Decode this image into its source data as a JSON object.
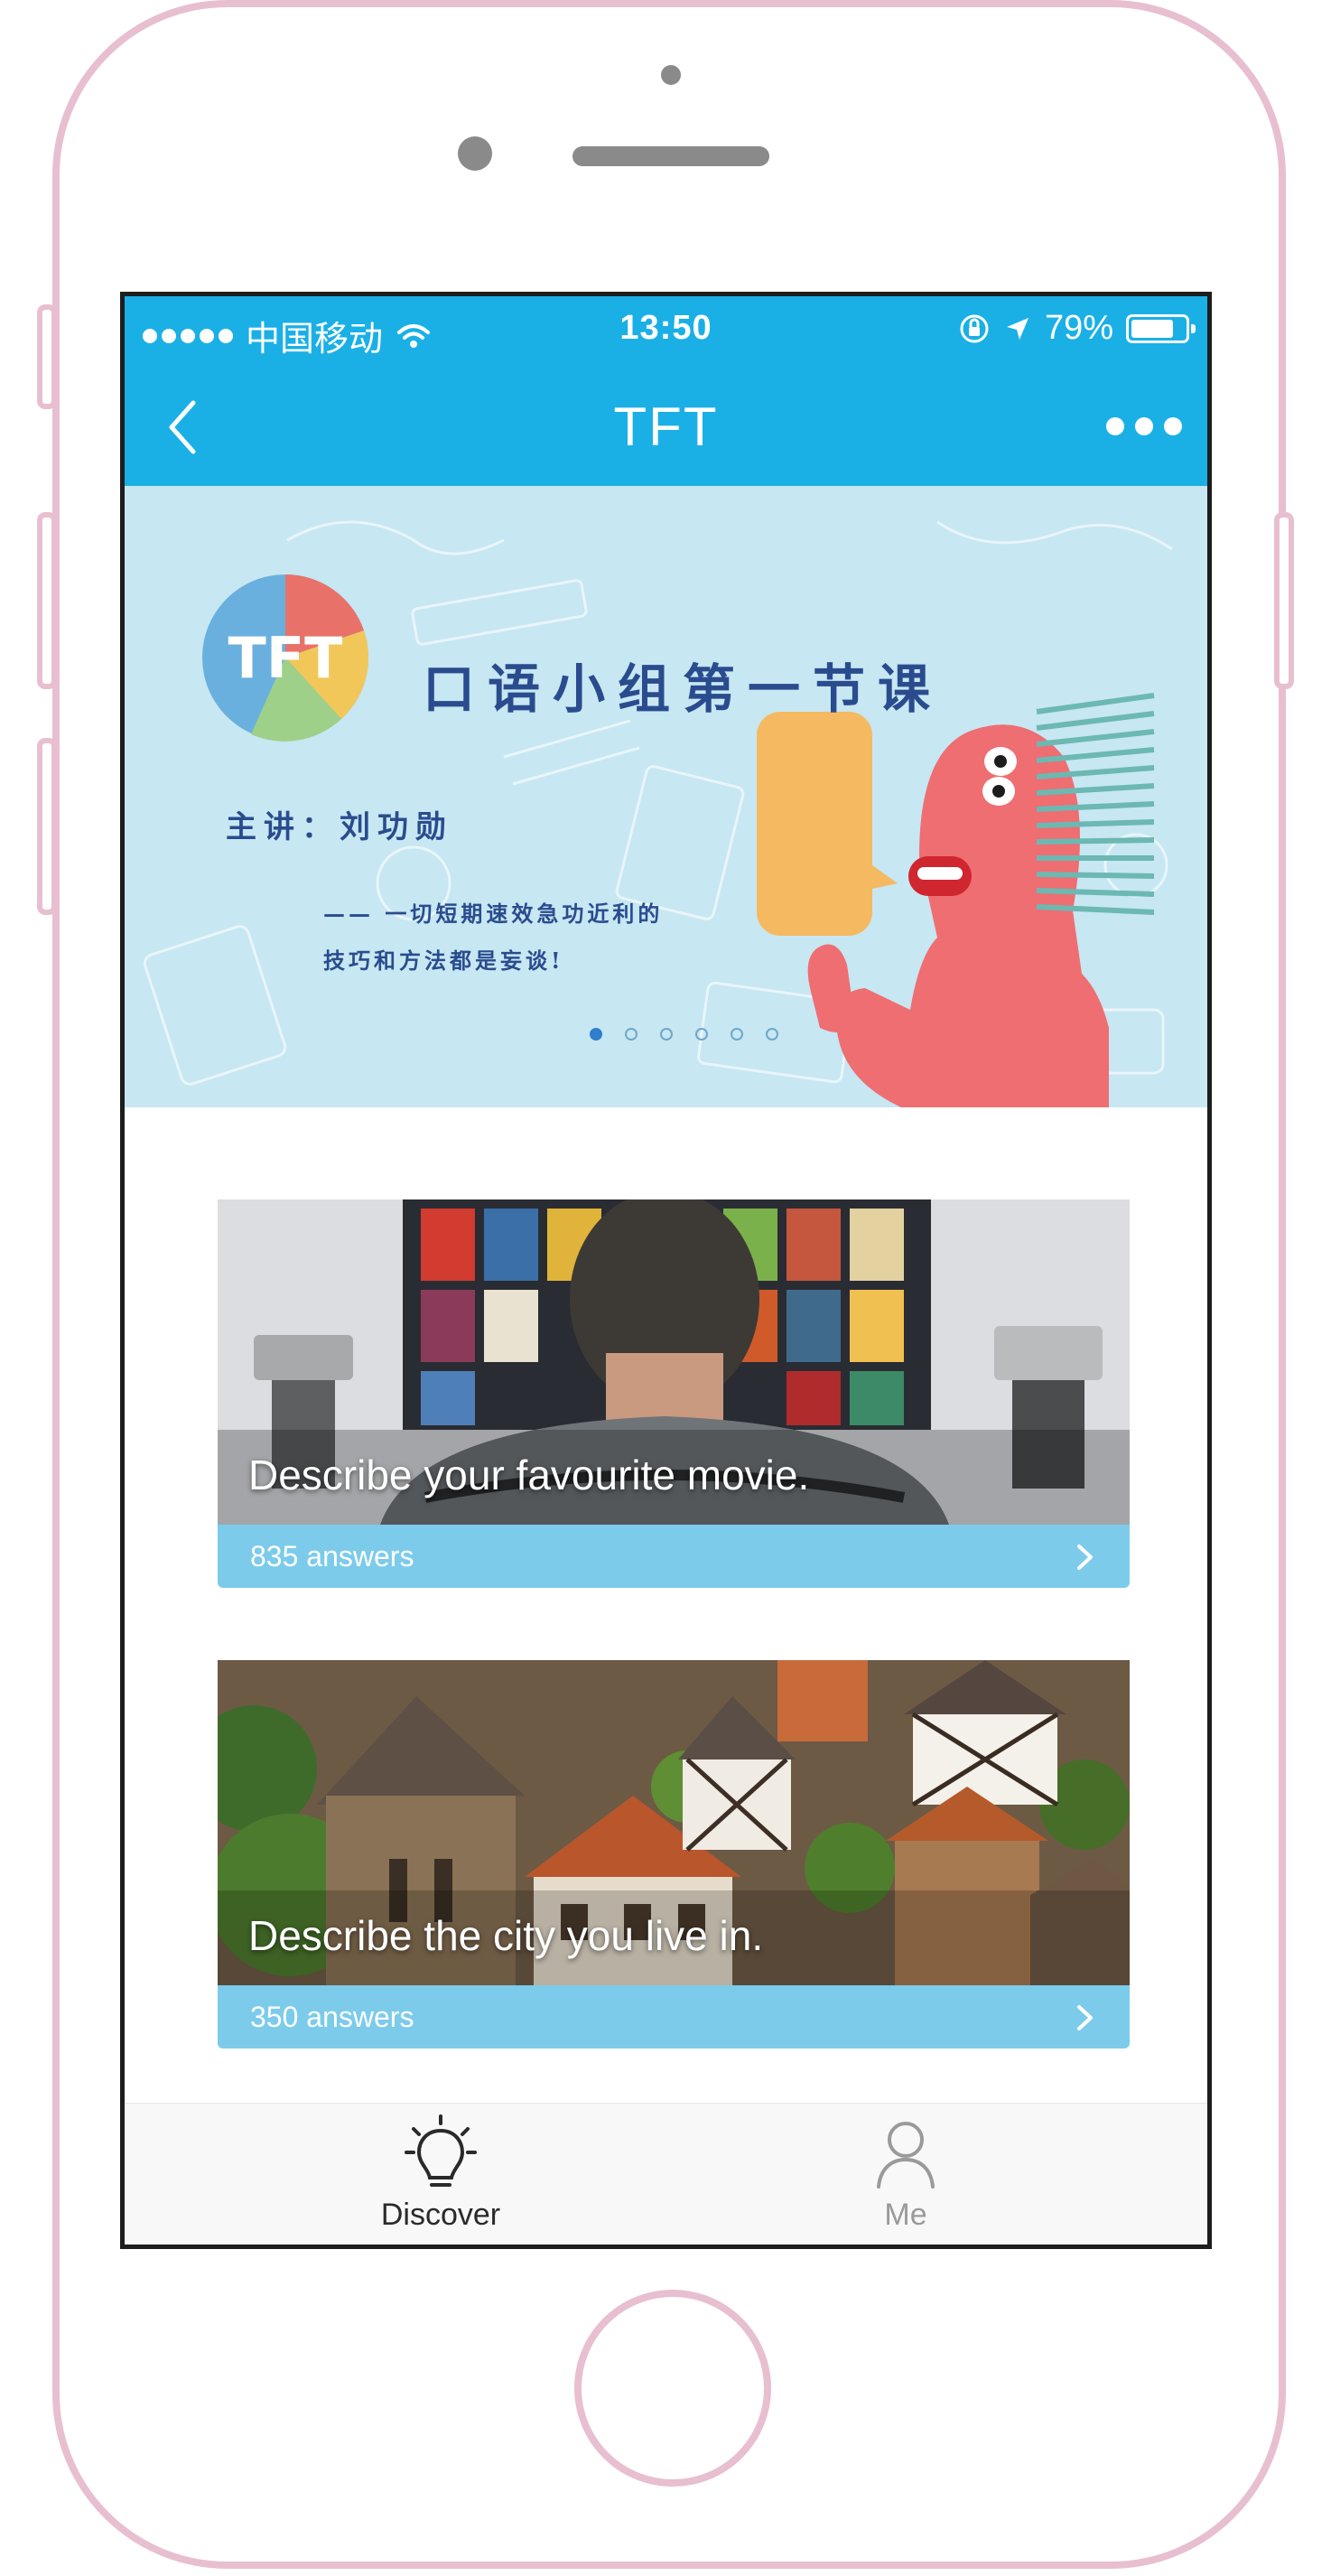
{
  "status_bar": {
    "carrier": "中国移动",
    "time": "13:50",
    "battery_percent": "79%",
    "battery_level": 0.79,
    "icons": [
      "signal-dots-icon",
      "wifi-icon",
      "orientation-lock-icon",
      "location-arrow-icon",
      "battery-icon"
    ]
  },
  "nav": {
    "title": "TFT",
    "back_icon": "chevron-left-icon",
    "more_icon": "more-dots-icon"
  },
  "banner": {
    "logo_text": "TFT",
    "title": "口语小组第一节课",
    "speaker": "主讲：刘功勋",
    "quote_line1": "—— 一切短期速效急功近利的",
    "quote_line2": "技巧和方法都是妄谈!",
    "page_count": 6,
    "active_page": 1
  },
  "cards": [
    {
      "caption": "Describe your favourite movie.",
      "answers": "835 answers"
    },
    {
      "caption": "Describe the city you live in.",
      "answers": "350 answers"
    }
  ],
  "tabs": [
    {
      "label": "Discover",
      "icon": "lightbulb-icon",
      "active": true
    },
    {
      "label": "Me",
      "icon": "person-icon",
      "active": false
    }
  ],
  "colors": {
    "accent": "#1ab0e6",
    "card_footer": "#7ccbeb",
    "phone_frame": "#e8bfd0",
    "banner_bg": "#c7e7f2",
    "banner_text": "#2a4c8e"
  }
}
